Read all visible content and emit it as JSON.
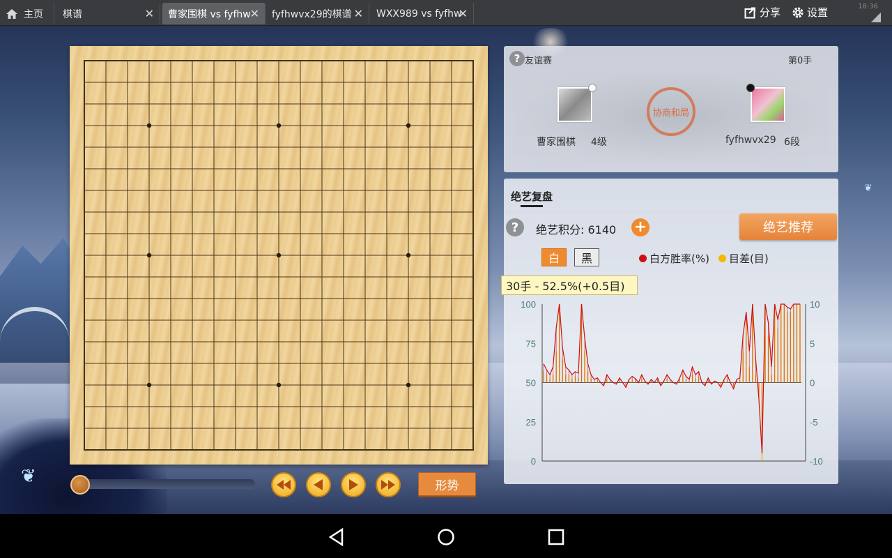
{
  "tabs": [
    {
      "label": "主页",
      "icon": "home-icon"
    },
    {
      "label": "棋谱",
      "closable": true
    },
    {
      "label": "曹家围棋 vs fyfhw",
      "closable": true,
      "active": true
    },
    {
      "label": "fyfhwvx29的棋谱",
      "closable": true
    },
    {
      "label": "WXX989 vs fyfhw",
      "closable": true
    }
  ],
  "topbar": {
    "share_label": "分享",
    "settings_label": "设置",
    "clock": "18:36"
  },
  "board": {
    "size": 19,
    "star_points": [
      [
        3,
        3
      ],
      [
        3,
        9
      ],
      [
        3,
        15
      ],
      [
        9,
        3
      ],
      [
        9,
        9
      ],
      [
        9,
        15
      ],
      [
        15,
        3
      ],
      [
        15,
        9
      ],
      [
        15,
        15
      ]
    ]
  },
  "game": {
    "type_label": "友谊赛",
    "move_label": "第0手",
    "result_seal": "协商和局",
    "white_player": {
      "name": "曹家围棋",
      "rank": "4级"
    },
    "black_player": {
      "name": "fyfhwvx29",
      "rank": "6段"
    }
  },
  "analysis": {
    "title": "绝艺复盘",
    "score_label": "绝艺积分: 6140",
    "recommend_label": "绝艺推荐",
    "side_white": "白",
    "side_black": "黑",
    "legend_winrate": "白方胜率(%)",
    "legend_diff": "目差(目)",
    "tooltip": "30手 - 52.5%(+0.5目)"
  },
  "controls": {
    "shape_label": "形势"
  },
  "colors": {
    "accent": "#ef8a2e",
    "winrate": "#cc1111",
    "diff": "#f5b800"
  },
  "chart_data": {
    "type": "bar",
    "left_axis": {
      "ticks": [
        "100",
        "75",
        "50",
        "25",
        "0"
      ],
      "ylim": [
        0,
        100
      ],
      "label": "白方胜率(%)"
    },
    "right_axis": {
      "ticks": [
        "10",
        "5",
        "0",
        "-5",
        "-10"
      ],
      "ylim": [
        -10,
        10
      ],
      "label": "目差(目)"
    },
    "series": [
      {
        "name": "白方胜率(%)",
        "color": "#cc1111",
        "values": [
          62,
          58,
          55,
          60,
          85,
          100,
          72,
          60,
          58,
          55,
          57,
          56,
          100,
          78,
          62,
          55,
          52,
          53,
          50,
          48,
          55,
          52,
          50,
          49,
          53,
          50,
          47,
          52,
          54,
          52.5,
          50,
          55,
          51,
          49,
          52,
          50,
          53,
          48,
          51,
          55,
          52,
          50,
          49,
          53,
          58,
          54,
          52,
          60,
          55,
          57,
          50,
          48,
          53,
          49,
          51,
          50,
          47,
          52,
          55,
          50,
          46,
          52,
          53,
          80,
          95,
          70,
          100,
          65,
          40,
          5,
          100,
          88,
          60,
          100,
          90,
          100,
          100,
          98,
          97,
          100,
          100,
          100
        ]
      },
      {
        "name": "目差(目)",
        "color": "#f5b800",
        "values": [
          1.5,
          1,
          0.5,
          1,
          4,
          10,
          3,
          1,
          1,
          0.5,
          0.8,
          0.6,
          10,
          4,
          1.5,
          0.5,
          0.2,
          0.3,
          0,
          -0.2,
          0.5,
          0.2,
          0,
          -0.1,
          0.3,
          0,
          -0.3,
          0.2,
          0.4,
          0.5,
          0,
          0.5,
          0.1,
          -0.1,
          0.2,
          0,
          0.3,
          -0.2,
          0.1,
          0.5,
          0.2,
          0,
          -0.1,
          0.3,
          1,
          0.4,
          0.2,
          1,
          0.5,
          0.7,
          0,
          -0.2,
          0.3,
          -0.1,
          0.1,
          0,
          -0.3,
          0.2,
          0.5,
          0,
          -0.4,
          0.2,
          0.3,
          4,
          8,
          2,
          10,
          1,
          -2,
          -10,
          10,
          6,
          1,
          10,
          7,
          10,
          10,
          9,
          9,
          10,
          10,
          10
        ]
      }
    ]
  }
}
